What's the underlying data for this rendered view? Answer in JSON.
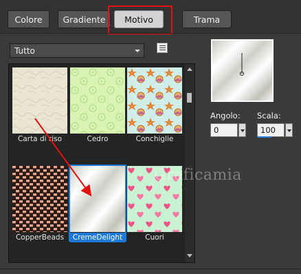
{
  "tabs": [
    {
      "label": "Colore"
    },
    {
      "label": "Gradiente"
    },
    {
      "label": "Motivo"
    },
    {
      "label": "Trama"
    }
  ],
  "active_tab": "Motivo",
  "category_select": {
    "value": "Tutto"
  },
  "patterns": [
    {
      "name": "Carta di riso"
    },
    {
      "name": "Cedro"
    },
    {
      "name": "Conchiglie"
    },
    {
      "name": "CopperBeads"
    },
    {
      "name": "CremeDelight"
    },
    {
      "name": "Cuori"
    }
  ],
  "selected_pattern": "CremeDelight",
  "angle": {
    "label": "Angolo:",
    "value": "0"
  },
  "scale": {
    "label": "Scala:",
    "value": "100"
  },
  "watermark": "Graficamia",
  "colors": {
    "accent": "#1e7ad8",
    "highlight": "#e51010"
  }
}
